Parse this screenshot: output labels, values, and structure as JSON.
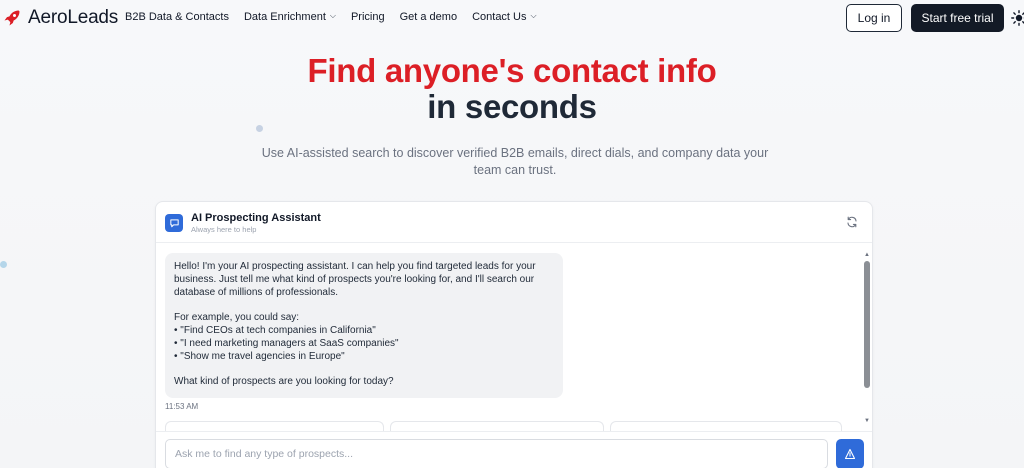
{
  "brand": {
    "name": "AeroLeads",
    "accent": "#dc1f26"
  },
  "nav": {
    "items": [
      {
        "label": "B2B Data & Contacts",
        "has_dropdown": false
      },
      {
        "label": "Data Enrichment",
        "has_dropdown": true
      },
      {
        "label": "Pricing",
        "has_dropdown": false
      },
      {
        "label": "Get a demo",
        "has_dropdown": false
      },
      {
        "label": "Contact Us",
        "has_dropdown": true
      }
    ],
    "login_label": "Log in",
    "trial_label": "Start free trial",
    "theme_icon": "sun-icon"
  },
  "hero": {
    "title": "Find anyone's contact info",
    "subtitle": "in seconds",
    "description": "Use AI-assisted search to discover verified B2B emails, direct dials, and company data your team can trust."
  },
  "chat": {
    "title": "AI Prospecting Assistant",
    "subtitle": "Always here to help",
    "message": "Hello! I'm your AI prospecting assistant. I can help you find targeted leads for your business. Just tell me what kind of prospects you're looking for, and I'll search our database of millions of professionals.\n\nFor example, you could say:\n• \"Find CEOs at tech companies in California\"\n• \"I need marketing managers at SaaS companies\"\n• \"Show me travel agencies in Europe\"\n\nWhat kind of prospects are you looking for today?",
    "timestamp": "11:53 AM",
    "input_placeholder": "Ask me to find any type of prospects...",
    "input_value": "",
    "accent": "#2f6bd9"
  }
}
